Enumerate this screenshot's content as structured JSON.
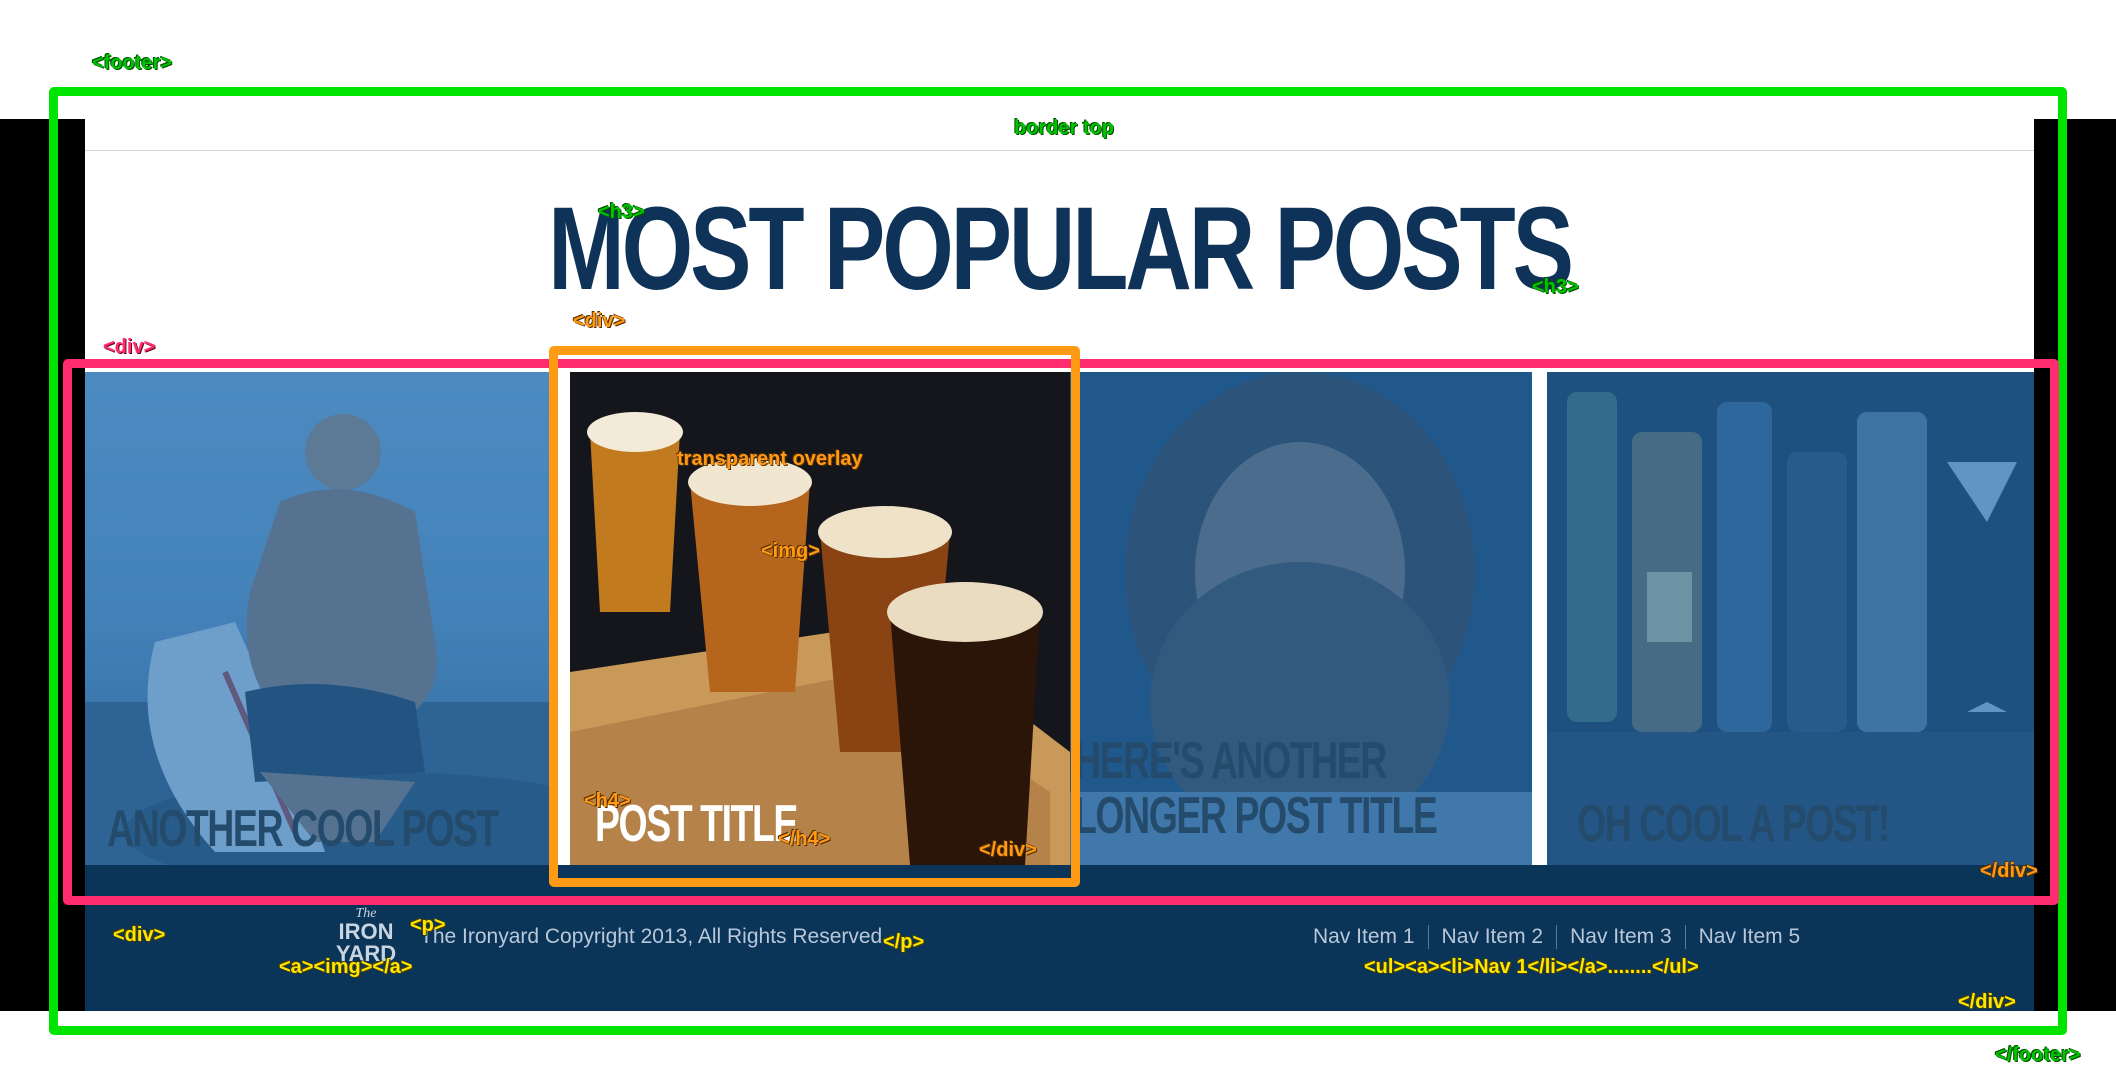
{
  "heading": "MOST POPULAR POSTS",
  "posts": [
    {
      "title": "ANOTHER COOL POST"
    },
    {
      "title": "POST TITLE"
    },
    {
      "title_line1": "HERE'S ANOTHER",
      "title_line2": "LONGER POST TITLE"
    },
    {
      "title": "OH COOL A POST!"
    }
  ],
  "footer": {
    "logo_lines": [
      "The",
      "IRON",
      "YARD"
    ],
    "copyright": "The Ironyard Copyright 2013, All Rights Reserved",
    "nav": [
      "Nav Item 1",
      "Nav Item 2",
      "Nav Item 3",
      "Nav Item 5"
    ]
  },
  "annotations": {
    "footer_open": "<footer>",
    "border_top": "border top",
    "h3_open": "<h3>",
    "h3_close": "<h3>",
    "div_card_open": "<div>",
    "div_open": "<div>",
    "transparent_overlay": "transparent overlay",
    "img": "<img>",
    "h4_open": "<h4>",
    "h4_close": "</h4>",
    "div_card_close": "</div>",
    "div_close_row": "</div>",
    "div_footer_open": "<div>",
    "p_open": "<p>",
    "p_close": "</p>",
    "a_img": "<a><img></a>",
    "ul_nav": "<ul><a><li>Nav 1</li></a>........</ul>",
    "div_footer_close": "</div>",
    "footer_close": "</footer>"
  },
  "colors": {
    "heading": "#0f3358",
    "footer_bg": "#0b3459",
    "overlay": "#236eb2",
    "annotation_footer": "#00e500",
    "annotation_div": "#ff2d6f",
    "annotation_card": "#ff9a14",
    "annotation_footer_inner": "#ffe600"
  }
}
